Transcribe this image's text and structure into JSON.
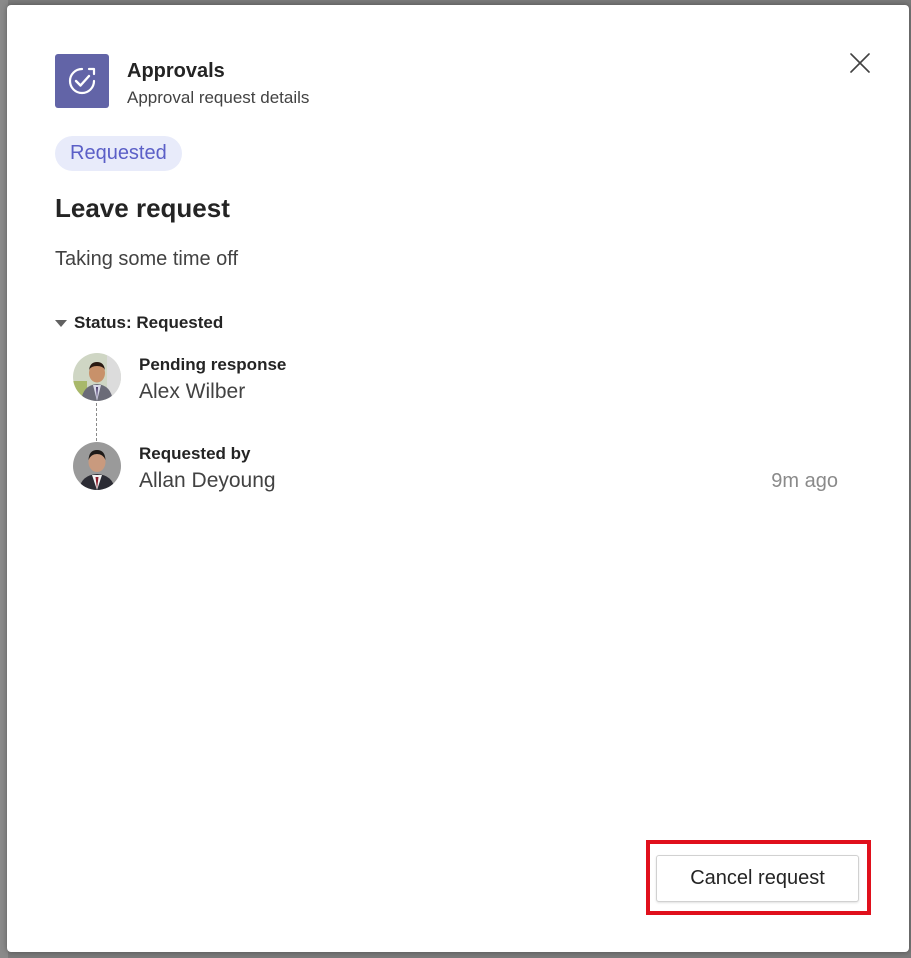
{
  "app": {
    "title": "Approvals",
    "subtitle": "Approval request details",
    "icon": "approvals-check-icon",
    "accent": "#6264a7"
  },
  "request": {
    "status_badge": "Requested",
    "title": "Leave request",
    "description": "Taking some time off"
  },
  "status_section": {
    "label": "Status: Requested",
    "steps": [
      {
        "label": "Pending response",
        "name": "Alex Wilber",
        "time": ""
      },
      {
        "label": "Requested by",
        "name": "Allan Deyoung",
        "time": "9m ago"
      }
    ]
  },
  "actions": {
    "cancel_label": "Cancel request",
    "highlight_color": "#e0101c"
  }
}
